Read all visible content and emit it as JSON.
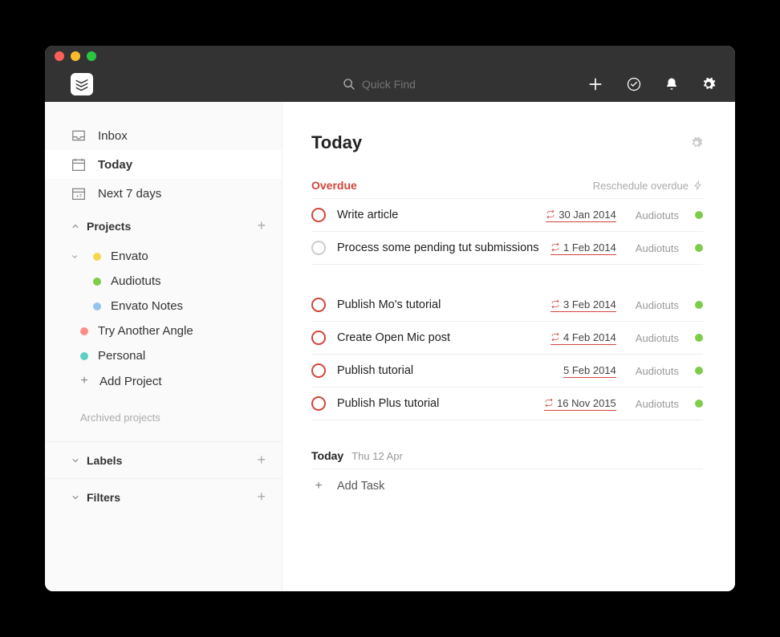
{
  "search": {
    "placeholder": "Quick Find"
  },
  "sidebar": {
    "nav": [
      {
        "label": "Inbox"
      },
      {
        "label": "Today"
      },
      {
        "label": "Next 7 days"
      }
    ],
    "projects_label": "Projects",
    "projects": [
      {
        "label": "Envato",
        "color": "#f3d74e",
        "children": [
          {
            "label": "Audiotuts",
            "color": "#7ecc49"
          },
          {
            "label": "Envato Notes",
            "color": "#96c3eb"
          }
        ]
      },
      {
        "label": "Try Another Angle",
        "color": "#ff8d85"
      },
      {
        "label": "Personal",
        "color": "#5ecfc2"
      }
    ],
    "add_project": "Add Project",
    "archived": "Archived projects",
    "labels_label": "Labels",
    "filters_label": "Filters"
  },
  "main": {
    "title": "Today",
    "overdue_label": "Overdue",
    "reschedule_label": "Reschedule overdue",
    "tasks_overdue_group1": [
      {
        "title": "Write article",
        "date": "30 Jan 2014",
        "recurring": true,
        "project": "Audiotuts",
        "proj_color": "#7ecc49",
        "priority": "red"
      },
      {
        "title": "Process some pending tut submissions",
        "date": "1 Feb 2014",
        "recurring": true,
        "project": "Audiotuts",
        "proj_color": "#7ecc49",
        "priority": "gray"
      }
    ],
    "tasks_overdue_group2": [
      {
        "title": "Publish Mo's tutorial",
        "date": "3 Feb 2014",
        "recurring": true,
        "project": "Audiotuts",
        "proj_color": "#7ecc49",
        "priority": "red"
      },
      {
        "title": "Create Open Mic post",
        "date": "4 Feb 2014",
        "recurring": true,
        "project": "Audiotuts",
        "proj_color": "#7ecc49",
        "priority": "red"
      },
      {
        "title": "Publish tutorial",
        "date": "5 Feb 2014",
        "recurring": false,
        "project": "Audiotuts",
        "proj_color": "#7ecc49",
        "priority": "red"
      },
      {
        "title": "Publish Plus tutorial",
        "date": "16 Nov 2015",
        "recurring": true,
        "project": "Audiotuts",
        "proj_color": "#7ecc49",
        "priority": "red"
      }
    ],
    "today_label": "Today",
    "today_date": "Thu 12 Apr",
    "add_task": "Add Task"
  }
}
